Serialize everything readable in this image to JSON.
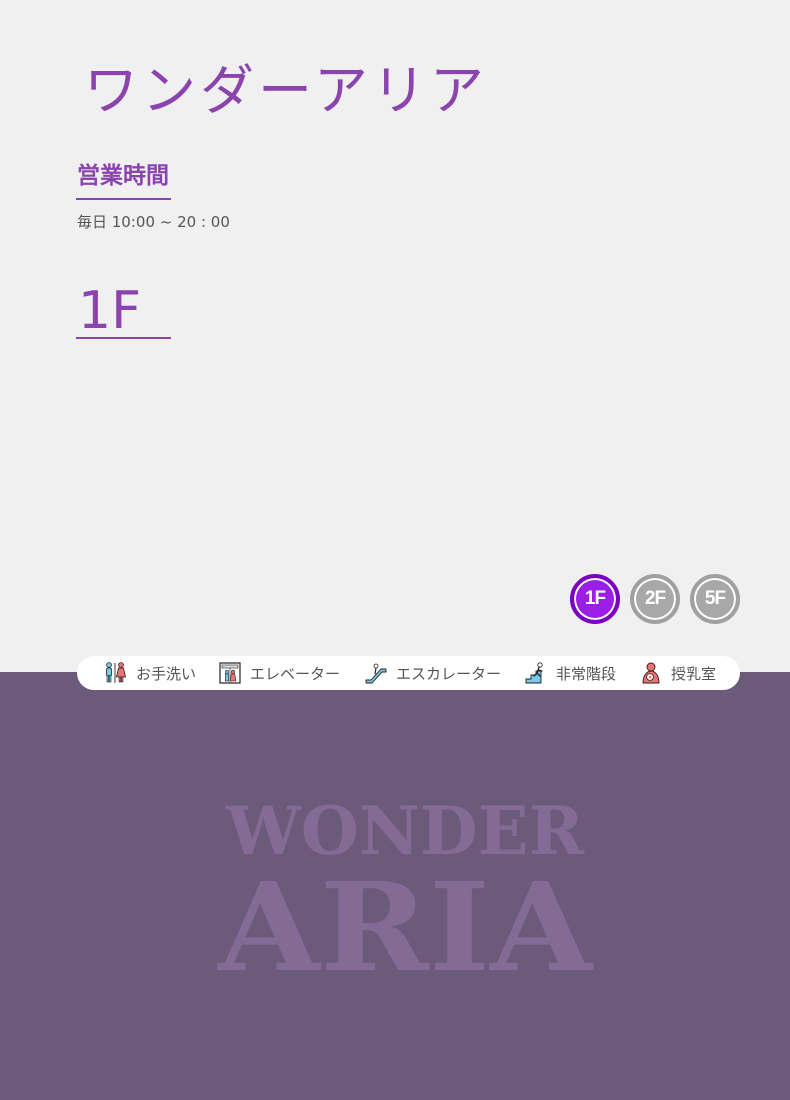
{
  "app": {
    "title": "ワンダーアリア"
  },
  "business_hours": {
    "heading": "営業時間",
    "text": "毎日 10:00 ~ 20 : 00"
  },
  "floor": {
    "current_label": "1F"
  },
  "floor_buttons": [
    {
      "label": "1F",
      "active": true
    },
    {
      "label": "2F",
      "active": false
    },
    {
      "label": "5F",
      "active": false
    }
  ],
  "legend": [
    {
      "label": "お手洗い",
      "icon": "restroom-icon"
    },
    {
      "label": "エレベーター",
      "icon": "elevator-icon"
    },
    {
      "label": "エスカレーター",
      "icon": "escalator-icon"
    },
    {
      "label": "非常階段",
      "icon": "emergency-stairs-icon"
    },
    {
      "label": "授乳室",
      "icon": "nursing-room-icon"
    }
  ],
  "logo": {
    "line1": "WONDER",
    "line2": "ARIA"
  },
  "colors": {
    "accent": "#8b44ad",
    "active_floor": "#9b1ee6",
    "inactive_floor": "#a8a8a8",
    "footer_bg": "#6b5a7a",
    "logo_fill": "#836b95",
    "page_bg": "#f0f0f0"
  }
}
